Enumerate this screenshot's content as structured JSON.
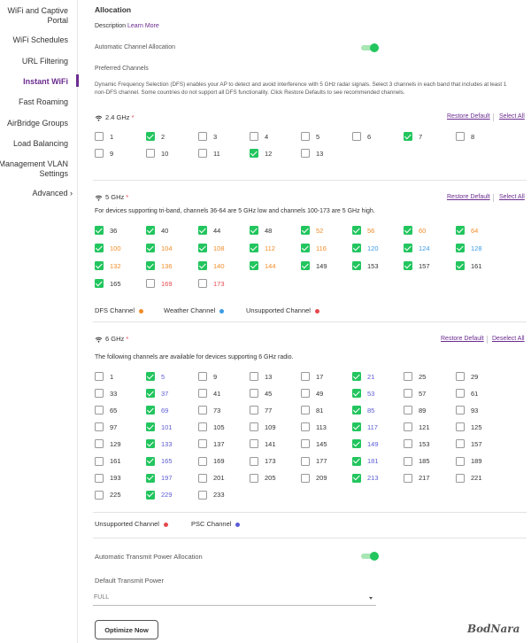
{
  "sidebar": {
    "items": [
      {
        "label": "WiFi and Captive Portal"
      },
      {
        "label": "WiFi Schedules"
      },
      {
        "label": "URL Filtering"
      },
      {
        "label": "Instant WiFi"
      },
      {
        "label": "Fast Roaming"
      },
      {
        "label": "AirBridge Groups"
      },
      {
        "label": "Load Balancing"
      },
      {
        "label": "Management VLAN Settings"
      },
      {
        "label": "Advanced ›"
      }
    ]
  },
  "allocation": {
    "title": "Allocation",
    "description_label": "Description",
    "learn_more": "Learn More",
    "auto_channel_label": "Automatic Channel Allocation",
    "auto_channel_on": true,
    "preferred_title": "Preferred Channels",
    "dfs_text": "Dynamic Frequency Selection (DFS) enables your AP to detect and avoid interference with 5 GHz radar signals. Select 3 channels in each band that includes at least 1 non-DFS channel. Some countries do not support all DFS functionality. Click Restore Defaults to see recommended channels."
  },
  "band24": {
    "title": "2.4 GHz",
    "required": "*",
    "restore": "Restore Default",
    "select": "Select All",
    "channels": [
      {
        "n": "1",
        "c": false,
        "t": ""
      },
      {
        "n": "2",
        "c": true,
        "t": ""
      },
      {
        "n": "3",
        "c": false,
        "t": ""
      },
      {
        "n": "4",
        "c": false,
        "t": ""
      },
      {
        "n": "5",
        "c": false,
        "t": ""
      },
      {
        "n": "6",
        "c": false,
        "t": ""
      },
      {
        "n": "7",
        "c": true,
        "t": ""
      },
      {
        "n": "8",
        "c": false,
        "t": ""
      },
      {
        "n": "9",
        "c": false,
        "t": ""
      },
      {
        "n": "10",
        "c": false,
        "t": ""
      },
      {
        "n": "11",
        "c": false,
        "t": ""
      },
      {
        "n": "12",
        "c": true,
        "t": ""
      },
      {
        "n": "13",
        "c": false,
        "t": ""
      }
    ]
  },
  "band5": {
    "title": "5 GHz",
    "required": "*",
    "restore": "Restore Default",
    "select": "Select All",
    "note": "For devices supporting tri-band, channels 36-64 are 5 GHz low and channels 100-173 are 5 GHz high.",
    "channels": [
      {
        "n": "36",
        "c": true,
        "t": ""
      },
      {
        "n": "40",
        "c": true,
        "t": ""
      },
      {
        "n": "44",
        "c": true,
        "t": ""
      },
      {
        "n": "48",
        "c": true,
        "t": ""
      },
      {
        "n": "52",
        "c": true,
        "t": "dfs"
      },
      {
        "n": "56",
        "c": true,
        "t": "dfs"
      },
      {
        "n": "60",
        "c": true,
        "t": "dfs"
      },
      {
        "n": "64",
        "c": true,
        "t": "dfs"
      },
      {
        "n": "100",
        "c": true,
        "t": "dfs"
      },
      {
        "n": "104",
        "c": true,
        "t": "dfs"
      },
      {
        "n": "108",
        "c": true,
        "t": "dfs"
      },
      {
        "n": "112",
        "c": true,
        "t": "dfs"
      },
      {
        "n": "116",
        "c": true,
        "t": "dfs"
      },
      {
        "n": "120",
        "c": true,
        "t": "weather"
      },
      {
        "n": "124",
        "c": true,
        "t": "weather"
      },
      {
        "n": "128",
        "c": true,
        "t": "weather"
      },
      {
        "n": "132",
        "c": true,
        "t": "dfs"
      },
      {
        "n": "136",
        "c": true,
        "t": "dfs"
      },
      {
        "n": "140",
        "c": true,
        "t": "dfs"
      },
      {
        "n": "144",
        "c": true,
        "t": "dfs"
      },
      {
        "n": "149",
        "c": true,
        "t": ""
      },
      {
        "n": "153",
        "c": true,
        "t": ""
      },
      {
        "n": "157",
        "c": true,
        "t": ""
      },
      {
        "n": "161",
        "c": true,
        "t": ""
      },
      {
        "n": "165",
        "c": true,
        "t": ""
      },
      {
        "n": "169",
        "c": false,
        "t": "unsup"
      },
      {
        "n": "173",
        "c": false,
        "t": "unsup"
      }
    ],
    "legend": [
      {
        "label": "DFS Channel",
        "color": "#f28c28"
      },
      {
        "label": "Weather Channel",
        "color": "#3b9be6"
      },
      {
        "label": "Unsupported Channel",
        "color": "#e5484d"
      }
    ]
  },
  "band6": {
    "title": "6 GHz",
    "required": "*",
    "restore": "Restore Default",
    "select": "Deselect All",
    "note": "The following channels are available for devices supporting 6 GHz radio.",
    "channels": [
      {
        "n": "1",
        "c": false,
        "t": ""
      },
      {
        "n": "5",
        "c": true,
        "t": "psc"
      },
      {
        "n": "9",
        "c": false,
        "t": ""
      },
      {
        "n": "13",
        "c": false,
        "t": ""
      },
      {
        "n": "17",
        "c": false,
        "t": ""
      },
      {
        "n": "21",
        "c": true,
        "t": "psc"
      },
      {
        "n": "25",
        "c": false,
        "t": ""
      },
      {
        "n": "29",
        "c": false,
        "t": ""
      },
      {
        "n": "33",
        "c": false,
        "t": ""
      },
      {
        "n": "37",
        "c": true,
        "t": "psc"
      },
      {
        "n": "41",
        "c": false,
        "t": ""
      },
      {
        "n": "45",
        "c": false,
        "t": ""
      },
      {
        "n": "49",
        "c": false,
        "t": ""
      },
      {
        "n": "53",
        "c": true,
        "t": "psc"
      },
      {
        "n": "57",
        "c": false,
        "t": ""
      },
      {
        "n": "61",
        "c": false,
        "t": ""
      },
      {
        "n": "65",
        "c": false,
        "t": ""
      },
      {
        "n": "69",
        "c": true,
        "t": "psc"
      },
      {
        "n": "73",
        "c": false,
        "t": ""
      },
      {
        "n": "77",
        "c": false,
        "t": ""
      },
      {
        "n": "81",
        "c": false,
        "t": ""
      },
      {
        "n": "85",
        "c": true,
        "t": "psc"
      },
      {
        "n": "89",
        "c": false,
        "t": ""
      },
      {
        "n": "93",
        "c": false,
        "t": ""
      },
      {
        "n": "97",
        "c": false,
        "t": ""
      },
      {
        "n": "101",
        "c": true,
        "t": "psc"
      },
      {
        "n": "105",
        "c": false,
        "t": ""
      },
      {
        "n": "109",
        "c": false,
        "t": ""
      },
      {
        "n": "113",
        "c": false,
        "t": ""
      },
      {
        "n": "117",
        "c": true,
        "t": "psc"
      },
      {
        "n": "121",
        "c": false,
        "t": ""
      },
      {
        "n": "125",
        "c": false,
        "t": ""
      },
      {
        "n": "129",
        "c": false,
        "t": ""
      },
      {
        "n": "133",
        "c": true,
        "t": "psc"
      },
      {
        "n": "137",
        "c": false,
        "t": ""
      },
      {
        "n": "141",
        "c": false,
        "t": ""
      },
      {
        "n": "145",
        "c": false,
        "t": ""
      },
      {
        "n": "149",
        "c": true,
        "t": "psc"
      },
      {
        "n": "153",
        "c": false,
        "t": ""
      },
      {
        "n": "157",
        "c": false,
        "t": ""
      },
      {
        "n": "161",
        "c": false,
        "t": ""
      },
      {
        "n": "165",
        "c": true,
        "t": "psc"
      },
      {
        "n": "169",
        "c": false,
        "t": ""
      },
      {
        "n": "173",
        "c": false,
        "t": ""
      },
      {
        "n": "177",
        "c": false,
        "t": ""
      },
      {
        "n": "181",
        "c": true,
        "t": "psc"
      },
      {
        "n": "185",
        "c": false,
        "t": ""
      },
      {
        "n": "189",
        "c": false,
        "t": ""
      },
      {
        "n": "193",
        "c": false,
        "t": ""
      },
      {
        "n": "197",
        "c": true,
        "t": "psc"
      },
      {
        "n": "201",
        "c": false,
        "t": ""
      },
      {
        "n": "205",
        "c": false,
        "t": ""
      },
      {
        "n": "209",
        "c": false,
        "t": ""
      },
      {
        "n": "213",
        "c": true,
        "t": "psc"
      },
      {
        "n": "217",
        "c": false,
        "t": ""
      },
      {
        "n": "221",
        "c": false,
        "t": ""
      },
      {
        "n": "225",
        "c": false,
        "t": ""
      },
      {
        "n": "229",
        "c": true,
        "t": "psc"
      },
      {
        "n": "233",
        "c": false,
        "t": ""
      }
    ],
    "legend": [
      {
        "label": "Unsupported Channel",
        "color": "#e5484d"
      },
      {
        "label": "PSC Channel",
        "color": "#5b5bd6"
      }
    ]
  },
  "power": {
    "auto_label": "Automatic Transmit Power Allocation",
    "auto_on": true,
    "default_label": "Default Transmit Power",
    "value": "FULL"
  },
  "optimize_label": "Optimize Now",
  "logo_text": "BodNara"
}
